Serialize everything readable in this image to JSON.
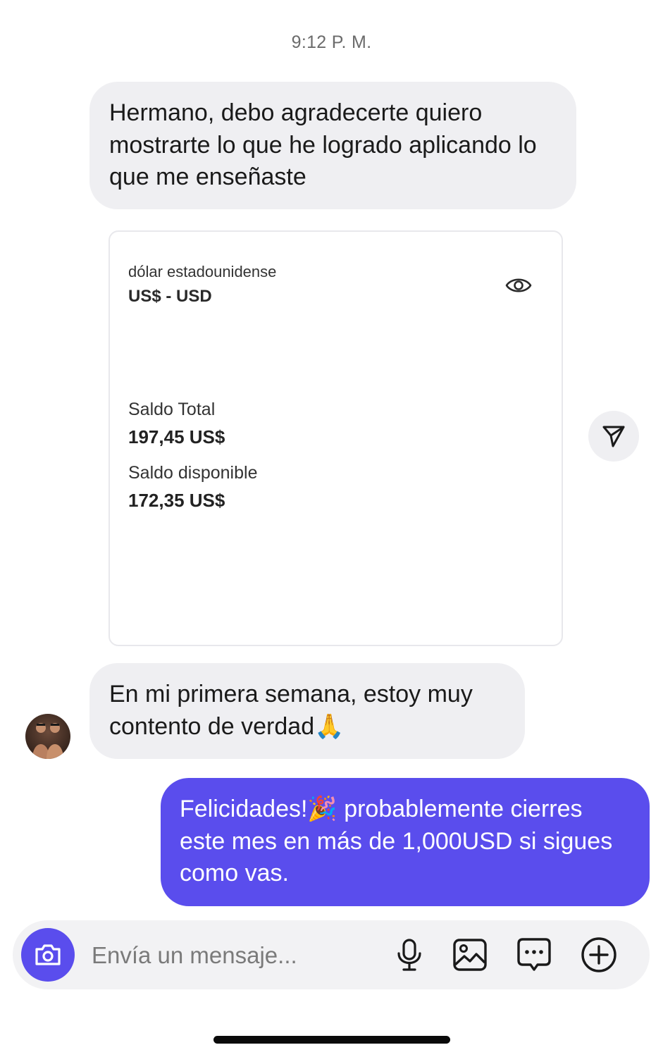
{
  "chat": {
    "timestamp": "9:12 P. M.",
    "messages": [
      {
        "from": "contact",
        "text": "Hermano, debo agradecerte quiero mostrarte lo que he logrado aplicando lo que me enseñaste"
      },
      {
        "from": "contact",
        "text": "En mi primera semana, estoy muy contento de verdad🙏"
      },
      {
        "from": "me",
        "text": "Felicidades!🎉 probablemente cierres este mes en más de 1,000USD si sigues como vas."
      }
    ]
  },
  "shared_card": {
    "currency_name": "dólar estadounidense",
    "currency_code": "US$ - USD",
    "total_label": "Saldo Total",
    "total_value": "197,45 US$",
    "available_label": "Saldo disponible",
    "available_value": "172,35 US$",
    "icon": "eye-icon"
  },
  "composer": {
    "placeholder": "Envía un mensaje...",
    "icons": [
      "camera-icon",
      "microphone-icon",
      "image-icon",
      "chat-bubble-icon",
      "plus-circle-icon"
    ]
  },
  "colors": {
    "accent": "#5a4ded",
    "incoming_bubble": "#efeff2",
    "composer_bg": "#f2f2f4"
  }
}
